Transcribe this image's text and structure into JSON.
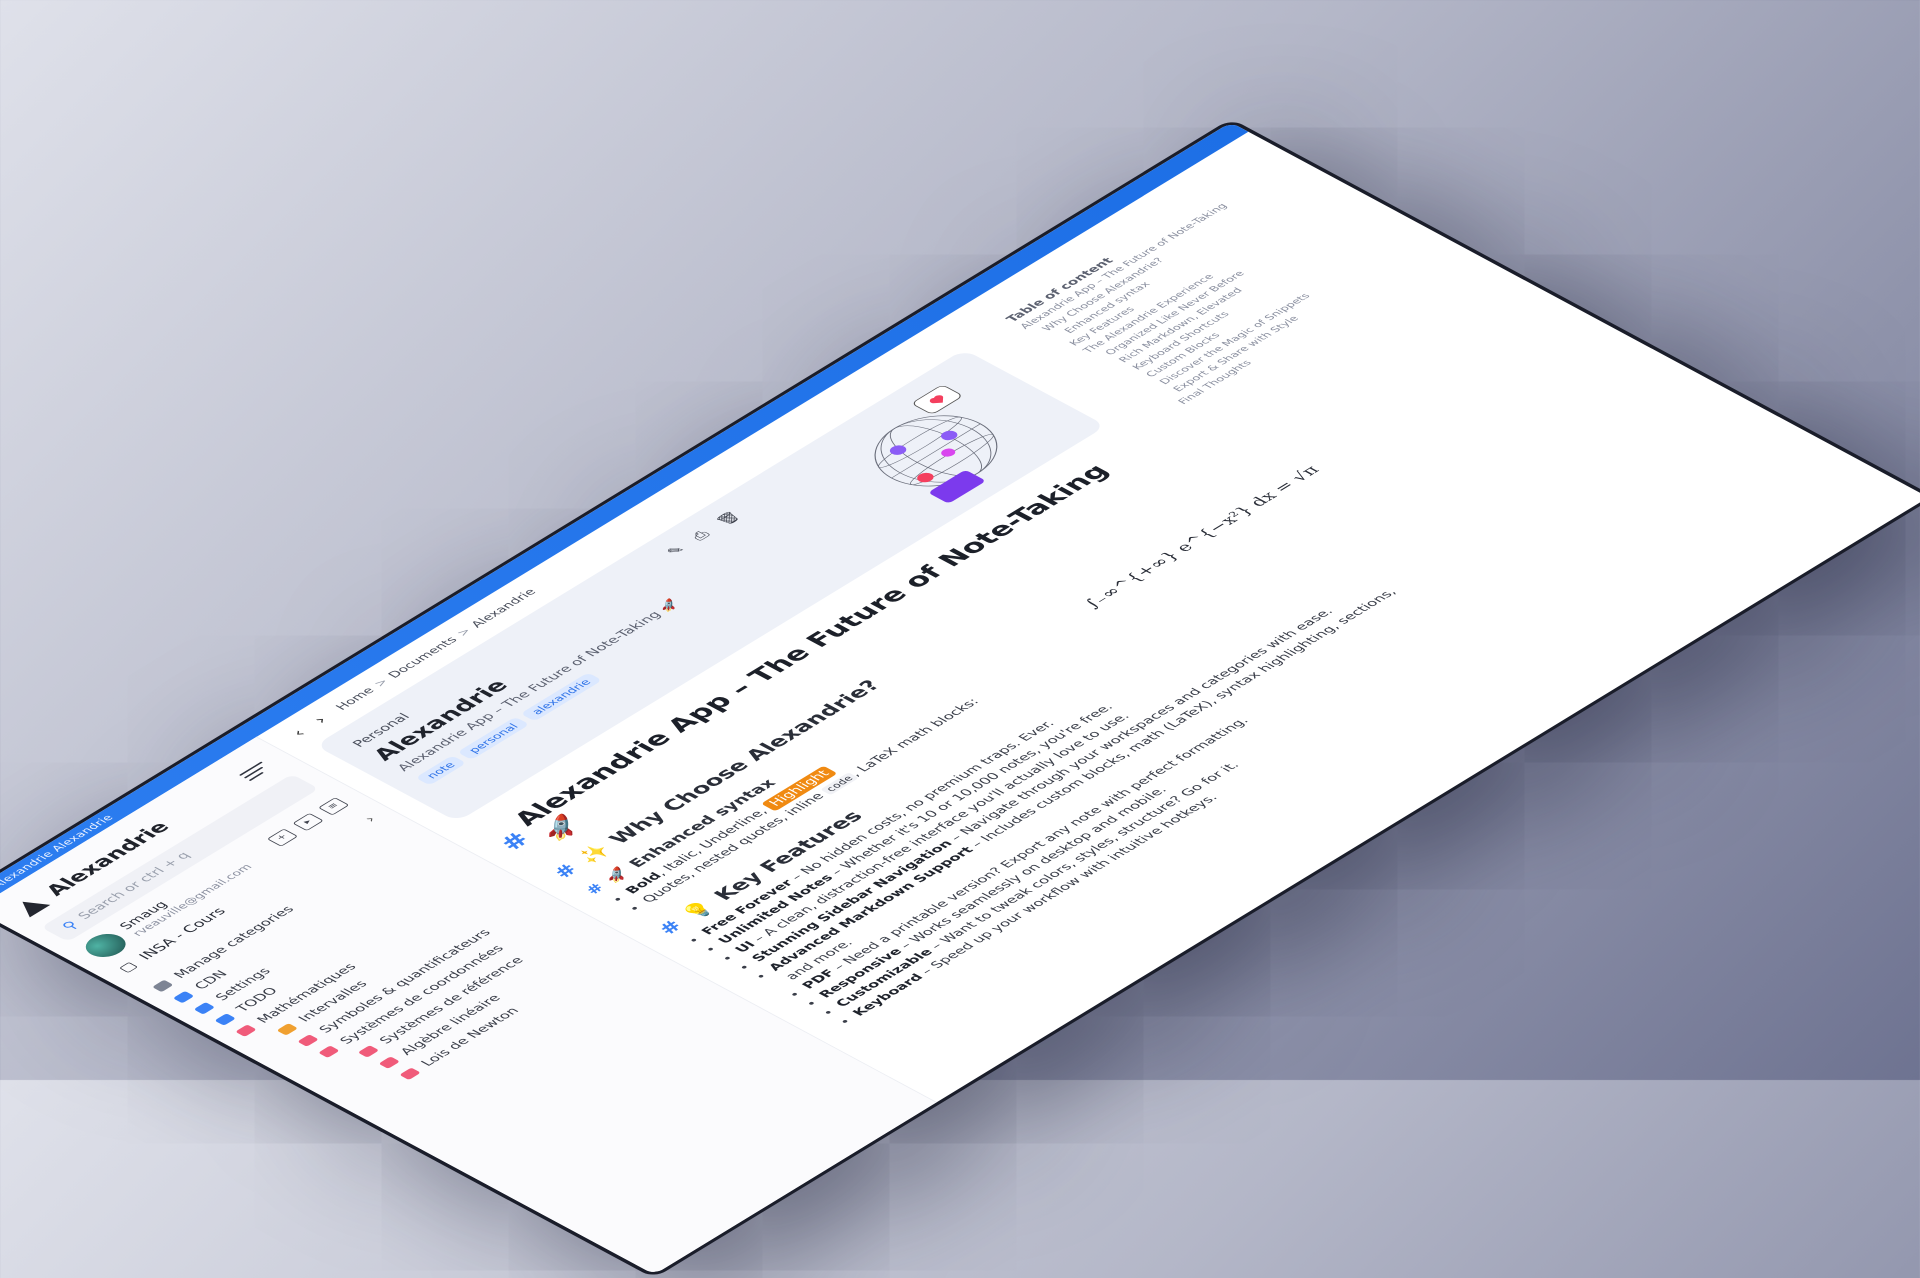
{
  "window": {
    "title": "Alexandrie Alexandrie"
  },
  "sidebar": {
    "brand": "Alexandrie",
    "search_placeholder": "Search or ctrl + q",
    "user": {
      "name": "Smaug",
      "email": "rveauville@gmail.com"
    },
    "workspace": "INSA - Cours",
    "items": [
      {
        "label": "Manage categories",
        "color": "#7d8494",
        "level": 0
      },
      {
        "label": "CDN",
        "color": "#3b82f6",
        "level": 0
      },
      {
        "label": "Settings",
        "color": "#3b82f6",
        "level": 0
      },
      {
        "label": "TODO",
        "color": "#3b82f6",
        "level": 0
      },
      {
        "label": "Mathématiques",
        "color": "#f05b7a",
        "level": 0
      },
      {
        "label": "Intervalles",
        "color": "#f0a030",
        "level": 1
      },
      {
        "label": "Symboles & quantificateurs",
        "color": "#f05b7a",
        "level": 1
      },
      {
        "label": "Systèmes de coordonnées",
        "color": "#f05b7a",
        "level": 1
      },
      {
        "label": "Systèmes de référence",
        "color": "#f05b7a",
        "level": 2
      },
      {
        "label": "Algèbre linéaire",
        "color": "#f05b7a",
        "level": 2
      },
      {
        "label": "Lois de Newton",
        "color": "#f05b7a",
        "level": 2
      }
    ]
  },
  "nav": {
    "breadcrumb": [
      "Home",
      "Documents",
      "Alexandrie"
    ]
  },
  "card": {
    "category": "Personal",
    "title": "Alexandrie",
    "description": "Alexandrie App – The Future of Note-Taking 🚀",
    "tags": [
      "note",
      "personal",
      "alexandrie"
    ]
  },
  "doc": {
    "h1": "Alexandrie App – The Future of Note-Taking 🚀",
    "h2_why": "Why Choose Alexandrie?",
    "h3_syntax": "Enhanced syntax",
    "syntax_line": {
      "bold": "Bold",
      "rest": ", Italic, Underline, ",
      "highlight": "Highlight"
    },
    "quotes_line": {
      "prefix": "Quotes, nested quotes, inline ",
      "code": "code",
      "suffix": ", LaTeX math blocks:"
    },
    "math": "∫₋∞^{+∞} e^{−x²} dx = √π",
    "h2_features": "Key Features",
    "features": [
      {
        "name": "Free Forever",
        "text": " – No hidden costs, no premium traps. Ever."
      },
      {
        "name": "Unlimited Notes",
        "text": " – Whether it's 10 or 10,000 notes, you're free."
      },
      {
        "name": "UI",
        "text": " – A clean, distraction-free interface you'll actually love to use."
      },
      {
        "name": "Stunning Sidebar Navigation",
        "text": " – Navigate through your workspaces and categories with ease."
      },
      {
        "name": "Advanced Markdown Support",
        "text": " – Includes custom blocks, math (LaTeX), syntax highlighting, sections, and more."
      },
      {
        "name": "PDF",
        "text": " – Need a printable version? Export any note with perfect formatting."
      },
      {
        "name": "Responsive",
        "text": " – Works seamlessly on desktop and mobile."
      },
      {
        "name": "Customizable",
        "text": " – Want to tweak colors, styles, structure? Go for it."
      },
      {
        "name": "Keyboard",
        "text": " – Speed up your workflow with intuitive hotkeys."
      }
    ]
  },
  "toc": {
    "title": "Table of content",
    "items": [
      {
        "label": "Alexandrie App – The Future of Note-Taking",
        "level": 0
      },
      {
        "label": "Why Choose Alexandrie?",
        "level": 1
      },
      {
        "label": "Enhanced syntax",
        "level": 2
      },
      {
        "label": "Key Features",
        "level": 1
      },
      {
        "label": "The Alexandrie Experience",
        "level": 1
      },
      {
        "label": "Organized Like Never Before",
        "level": 2
      },
      {
        "label": "Rich Markdown, Elevated",
        "level": 2
      },
      {
        "label": "Keyboard Shortcuts",
        "level": 2
      },
      {
        "label": "Custom Blocks",
        "level": 2
      },
      {
        "label": "Discover the Magic of Snippets",
        "level": 2
      },
      {
        "label": "Export & Share with Style",
        "level": 2
      },
      {
        "label": "Final Thoughts",
        "level": 1
      }
    ]
  },
  "colors": {
    "accent": "#3b82f6",
    "titlebar": "#1d6fe6",
    "highlight": "#f08a12"
  }
}
